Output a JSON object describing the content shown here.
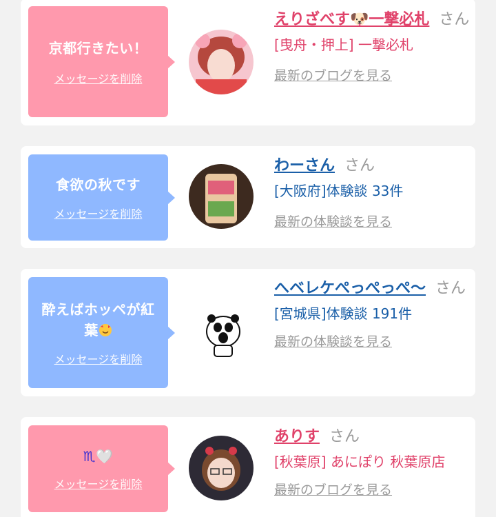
{
  "cards": [
    {
      "message": "京都行きたい！",
      "delete_label": "メッセージを削除",
      "name": "えりざべす🐶一撃必札",
      "san": "さん",
      "sub": "[曳舟・押上] 一撃必札",
      "latest": "最新のブログを見る",
      "theme": "pink"
    },
    {
      "message": "食欲の秋です",
      "delete_label": "メッセージを削除",
      "name": "わーさん",
      "san": "さん",
      "sub": "[大阪府]体験談 33件",
      "latest": "最新の体験談を見る",
      "theme": "blue"
    },
    {
      "message": "酔えばホッペが紅葉",
      "delete_label": "メッセージを削除",
      "name": "へベレケぺっぺっぺ〜",
      "san": "さん",
      "sub": "[宮城県]体験談 191件",
      "latest": "最新の体験談を見る",
      "theme": "blue"
    },
    {
      "message": "♏🤍",
      "delete_label": "メッセージを削除",
      "name": "ありす",
      "san": "さん",
      "sub": "[秋葉原] あにぽり 秋葉原店",
      "latest": "最新のブログを見る",
      "theme": "pink"
    }
  ]
}
